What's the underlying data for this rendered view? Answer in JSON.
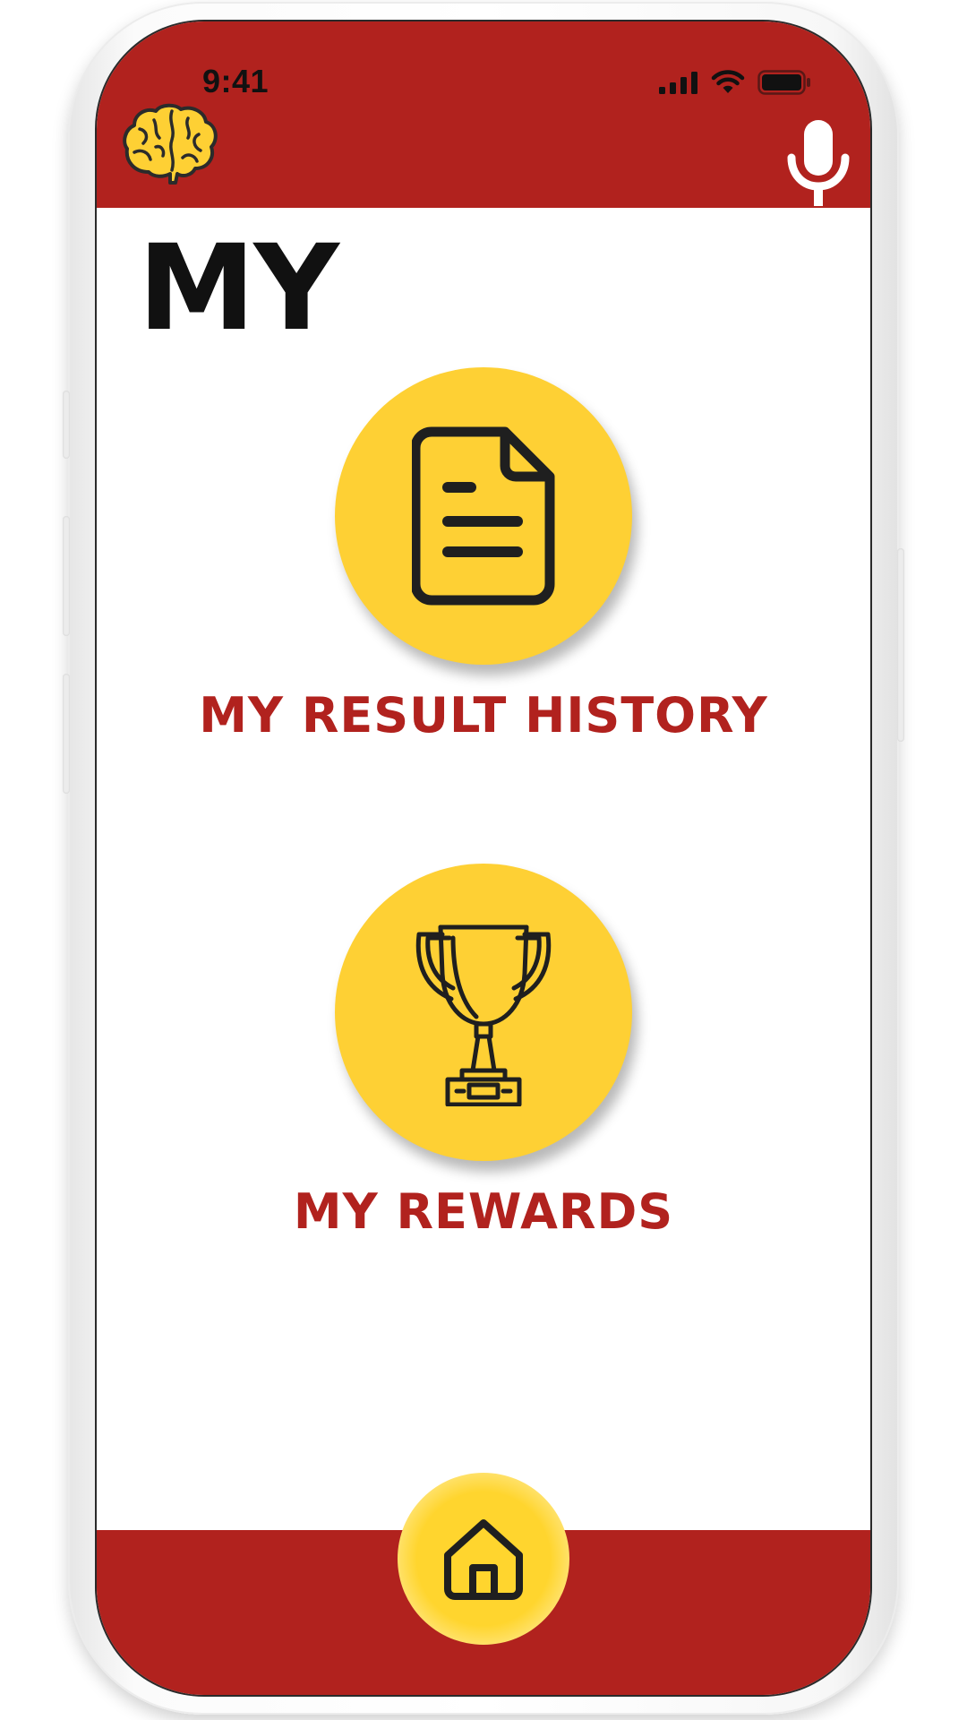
{
  "colors": {
    "brand_red": "#b1221e",
    "accent_yellow": "#fed034",
    "icon_dark": "#1f1f1f"
  },
  "status_bar": {
    "time": "9:41",
    "icons": [
      "signal-icon",
      "wifi-icon",
      "battery-icon"
    ]
  },
  "header": {
    "logo_icon": "brain-icon",
    "mic_icon": "microphone-icon"
  },
  "page": {
    "title": "MY"
  },
  "menu": [
    {
      "label": "MY RESULT HISTORY",
      "icon": "document-icon"
    },
    {
      "label": "MY REWARDS",
      "icon": "trophy-icon"
    }
  ],
  "bottom_nav": {
    "home_icon": "home-icon"
  }
}
